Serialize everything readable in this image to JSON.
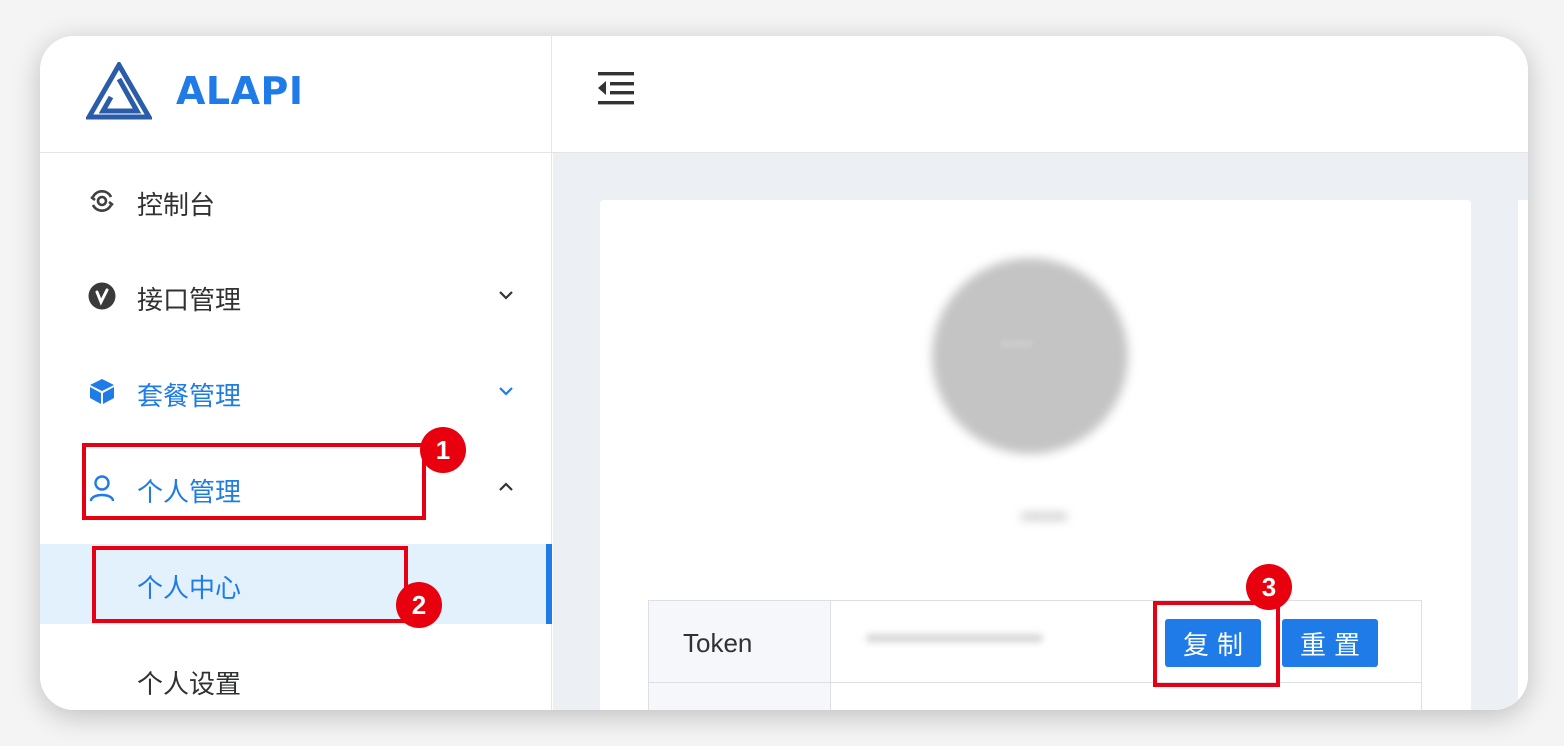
{
  "logo": {
    "text": "ALAPI"
  },
  "sidebar": {
    "items": [
      {
        "label": "控制台",
        "icon": "dashboard-icon"
      },
      {
        "label": "接口管理",
        "icon": "api-icon",
        "chevron": "down"
      },
      {
        "label": "套餐管理",
        "icon": "package-icon",
        "chevron": "down",
        "highlighted": true
      },
      {
        "label": "个人管理",
        "icon": "user-icon",
        "chevron": "up",
        "highlighted": true,
        "expanded": true
      }
    ],
    "subitems": [
      {
        "label": "个人中心",
        "active": true
      },
      {
        "label": "个人设置",
        "active": false
      }
    ]
  },
  "topbar": {
    "collapse_icon": "menu-fold-icon"
  },
  "profile": {
    "avatar_text": "avatar",
    "username": "••••••"
  },
  "token": {
    "label": "Token",
    "value": "••••••••••••••••••••••",
    "copy_label": "复制",
    "reset_label": "重置"
  },
  "annotations": [
    "1",
    "2",
    "3"
  ],
  "colors": {
    "accent": "#1e7be8",
    "highlight": "#e60012",
    "active_bg": "#e3f1fc"
  }
}
